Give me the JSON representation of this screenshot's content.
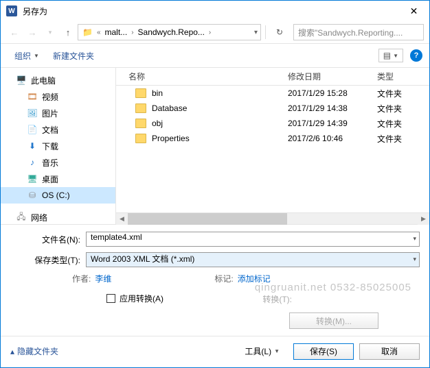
{
  "title": "另存为",
  "breadcrumb": {
    "seg1": "malt...",
    "seg2": "Sandwych.Repo...",
    "icon": "«"
  },
  "search_placeholder": "搜索\"Sandwych.Reporting....",
  "toolbar": {
    "organize": "组织",
    "newfolder": "新建文件夹"
  },
  "sidebar": {
    "thispc": "此电脑",
    "videos": "视频",
    "pictures": "图片",
    "documents": "文档",
    "downloads": "下载",
    "music": "音乐",
    "desktop": "桌面",
    "osc": "OS (C:)",
    "network": "网络"
  },
  "columns": {
    "name": "名称",
    "date": "修改日期",
    "type": "类型"
  },
  "files": [
    {
      "name": "bin",
      "date": "2017/1/29 15:28",
      "type": "文件夹"
    },
    {
      "name": "Database",
      "date": "2017/1/29 14:38",
      "type": "文件夹"
    },
    {
      "name": "obj",
      "date": "2017/1/29 14:39",
      "type": "文件夹"
    },
    {
      "name": "Properties",
      "date": "2017/2/6 10:46",
      "type": "文件夹"
    }
  ],
  "filename_label": "文件名(N):",
  "filename_value": "template4.xml",
  "filetype_label": "保存类型(T):",
  "filetype_value": "Word 2003 XML 文档 (*.xml)",
  "author_label": "作者:",
  "author_value": "李维",
  "tags_label": "标记:",
  "tags_value": "添加标记",
  "apply_transform": "应用转换(A)",
  "transform_label": "转换(T):",
  "transform_btn": "转换(M)...",
  "hide_folders": "隐藏文件夹",
  "tools": "工具(L)",
  "save": "保存(S)",
  "cancel": "取消",
  "watermark": "qingruanit.net 0532-85025005"
}
